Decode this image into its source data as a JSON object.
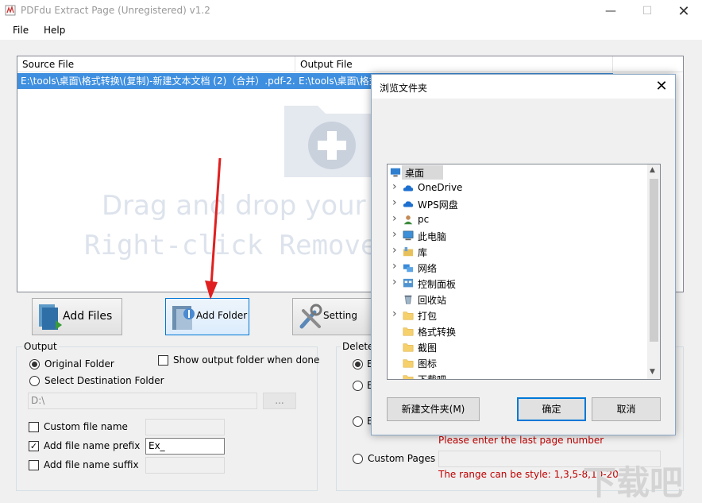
{
  "window": {
    "title": "PDFdu Extract Page (Unregistered) v1.2"
  },
  "menu": [
    "File",
    "Help"
  ],
  "filelist": {
    "columns": [
      "Source File",
      "Output File"
    ],
    "rows": [
      {
        "source": "E:\\tools\\桌面\\格式转换\\(复制)-新建文本文档 (2)（合并）.pdf-2...",
        "output": "E:\\tools\\桌面\\格式"
      }
    ],
    "drop_hint_1": "Drag and drop your fi",
    "drop_hint_2": "Right-click Remove"
  },
  "buttons": {
    "add_files": "Add Files",
    "add_folder": "Add Folder",
    "setting": "Setting"
  },
  "output": {
    "title": "Output",
    "original_folder": "Original Folder",
    "select_dest": "Select Destination Folder",
    "show_folder": "Show output folder when done",
    "path": "D:\\",
    "browse": "...",
    "custom_name": "Custom file name",
    "add_prefix": "Add file name prefix",
    "prefix_value": "Ex_",
    "add_suffix": "Add file name suffix"
  },
  "delete": {
    "title": "Delete",
    "radio_b1": "E",
    "radio_b2": "E",
    "radio_b3": "E",
    "last_page_hint": "Please enter the last page number",
    "custom_pages": "Custom Pages",
    "range_hint": "The range can be style:  1,3,5-8,10-20"
  },
  "dialog": {
    "title": "浏览文件夹",
    "tree": [
      {
        "label": "桌面",
        "icon": "desktop-icon",
        "expandable": false,
        "root": true,
        "selected": true
      },
      {
        "label": "OneDrive",
        "icon": "cloud-icon",
        "expandable": true
      },
      {
        "label": "WPS网盘",
        "icon": "cloud-icon",
        "expandable": true
      },
      {
        "label": "pc",
        "icon": "user-icon",
        "expandable": true
      },
      {
        "label": "此电脑",
        "icon": "computer-icon",
        "expandable": true
      },
      {
        "label": "库",
        "icon": "library-icon",
        "expandable": true
      },
      {
        "label": "网络",
        "icon": "network-icon",
        "expandable": true
      },
      {
        "label": "控制面板",
        "icon": "control-panel-icon",
        "expandable": true
      },
      {
        "label": "回收站",
        "icon": "recycle-bin-icon",
        "expandable": false
      },
      {
        "label": "打包",
        "icon": "folder-icon",
        "expandable": true
      },
      {
        "label": "格式转换",
        "icon": "folder-icon",
        "expandable": false
      },
      {
        "label": "截图",
        "icon": "folder-icon",
        "expandable": false
      },
      {
        "label": "图标",
        "icon": "folder-icon",
        "expandable": false
      },
      {
        "label": "下载吧",
        "icon": "folder-icon",
        "expandable": false
      }
    ],
    "new_folder": "新建文件夹(M)",
    "ok": "确定",
    "cancel": "取消"
  },
  "colors": {
    "selection": "#3e8fe0",
    "accent": "#0078d7",
    "hint_red": "#c00000",
    "arrow_red": "#e02020"
  }
}
